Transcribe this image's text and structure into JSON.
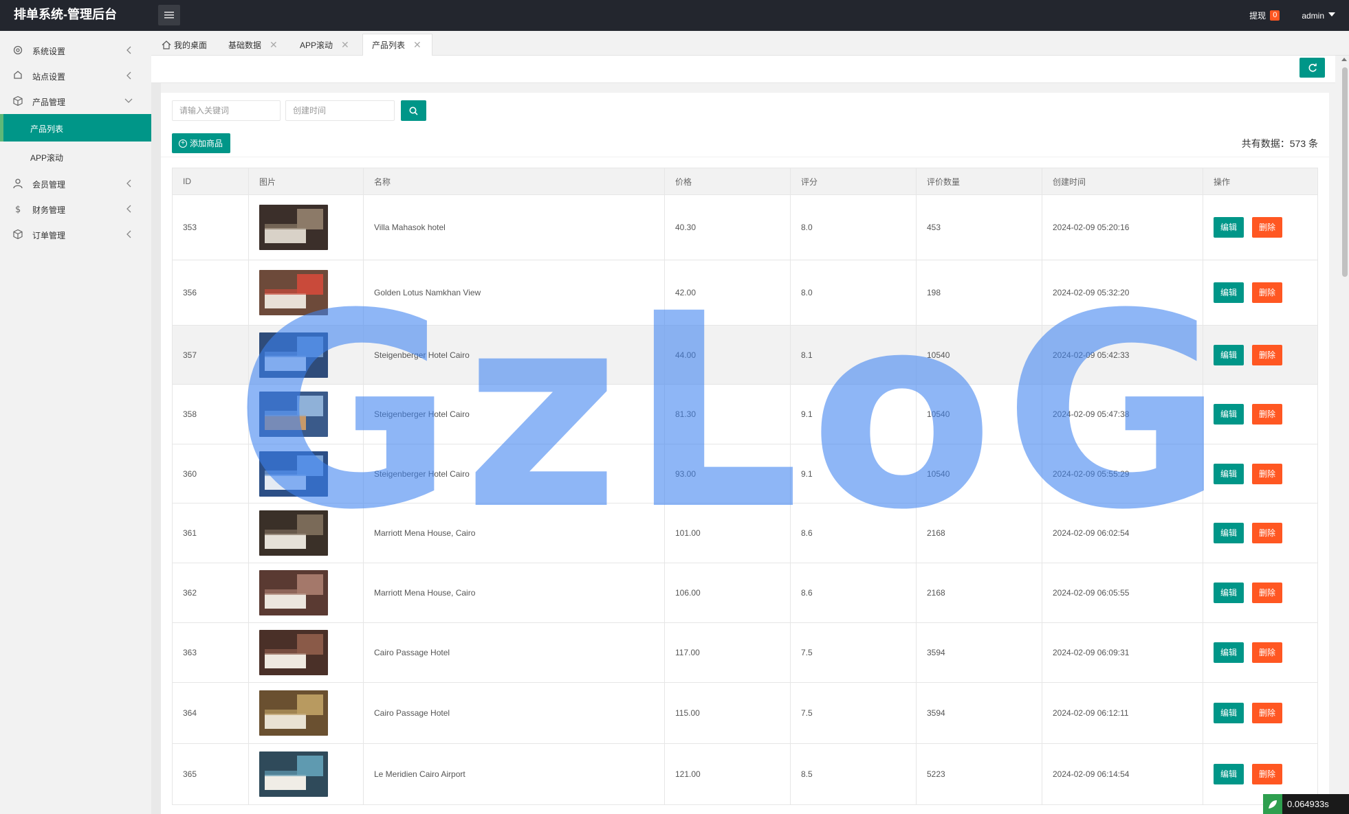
{
  "header": {
    "title": "排单系统-管理后台",
    "withdraw_label": "提现",
    "withdraw_count": "0",
    "user": "admin"
  },
  "sidebar": {
    "items": [
      {
        "label": "系统设置",
        "icon": "gear-icon"
      },
      {
        "label": "站点设置",
        "icon": "site-icon"
      },
      {
        "label": "产品管理",
        "icon": "cube-icon"
      },
      {
        "label": "产品列表"
      },
      {
        "label": "APP滚动"
      },
      {
        "label": "会员管理",
        "icon": "user-icon"
      },
      {
        "label": "财务管理",
        "icon": "dollar-icon"
      },
      {
        "label": "订单管理",
        "icon": "order-icon"
      }
    ]
  },
  "tabs": [
    {
      "label": "我的桌面",
      "icon": "home-icon"
    },
    {
      "label": "基础数据"
    },
    {
      "label": "APP滚动"
    },
    {
      "label": "产品列表"
    }
  ],
  "search": {
    "keyword_placeholder": "请输入关键词",
    "date_placeholder": "创建时间"
  },
  "toolbar": {
    "add_label": "添加商品",
    "total_label": "共有数据：573 条"
  },
  "table": {
    "columns": [
      "ID",
      "图片",
      "名称",
      "价格",
      "评分",
      "评价数量",
      "创建时间",
      "操作"
    ],
    "edit_label": "编辑",
    "delete_label": "删除",
    "rows": [
      {
        "id": "353",
        "name": "Villa Mahasok hotel",
        "price": "40.30",
        "score": "8.0",
        "reviews": "453",
        "created": "2024-02-09 05:20:16"
      },
      {
        "id": "356",
        "name": "Golden Lotus Namkhan View",
        "price": "42.00",
        "score": "8.0",
        "reviews": "198",
        "created": "2024-02-09 05:32:20"
      },
      {
        "id": "357",
        "name": "Steigenberger Hotel Cairo",
        "price": "44.00",
        "score": "8.1",
        "reviews": "10540",
        "created": "2024-02-09 05:42:33"
      },
      {
        "id": "358",
        "name": "Steigenberger Hotel Cairo",
        "price": "81.30",
        "score": "9.1",
        "reviews": "10540",
        "created": "2024-02-09 05:47:38"
      },
      {
        "id": "360",
        "name": "Steigenberger Hotel Cairo",
        "price": "93.00",
        "score": "9.1",
        "reviews": "10540",
        "created": "2024-02-09 05:55:29"
      },
      {
        "id": "361",
        "name": "Marriott Mena House, Cairo",
        "price": "101.00",
        "score": "8.6",
        "reviews": "2168",
        "created": "2024-02-09 06:02:54"
      },
      {
        "id": "362",
        "name": "Marriott Mena House, Cairo",
        "price": "106.00",
        "score": "8.6",
        "reviews": "2168",
        "created": "2024-02-09 06:05:55"
      },
      {
        "id": "363",
        "name": "Cairo Passage Hotel",
        "price": "117.00",
        "score": "7.5",
        "reviews": "3594",
        "created": "2024-02-09 06:09:31"
      },
      {
        "id": "364",
        "name": "Cairo Passage Hotel",
        "price": "115.00",
        "score": "7.5",
        "reviews": "3594",
        "created": "2024-02-09 06:12:11"
      },
      {
        "id": "365",
        "name": "Le Meridien Cairo Airport",
        "price": "121.00",
        "score": "8.5",
        "reviews": "5223",
        "created": "2024-02-09 06:14:54"
      }
    ]
  },
  "watermark": "GzLoG",
  "timer": "0.064933s",
  "colors": {
    "primary": "#009688",
    "danger": "#ff5722",
    "header_bg": "#23262e"
  }
}
